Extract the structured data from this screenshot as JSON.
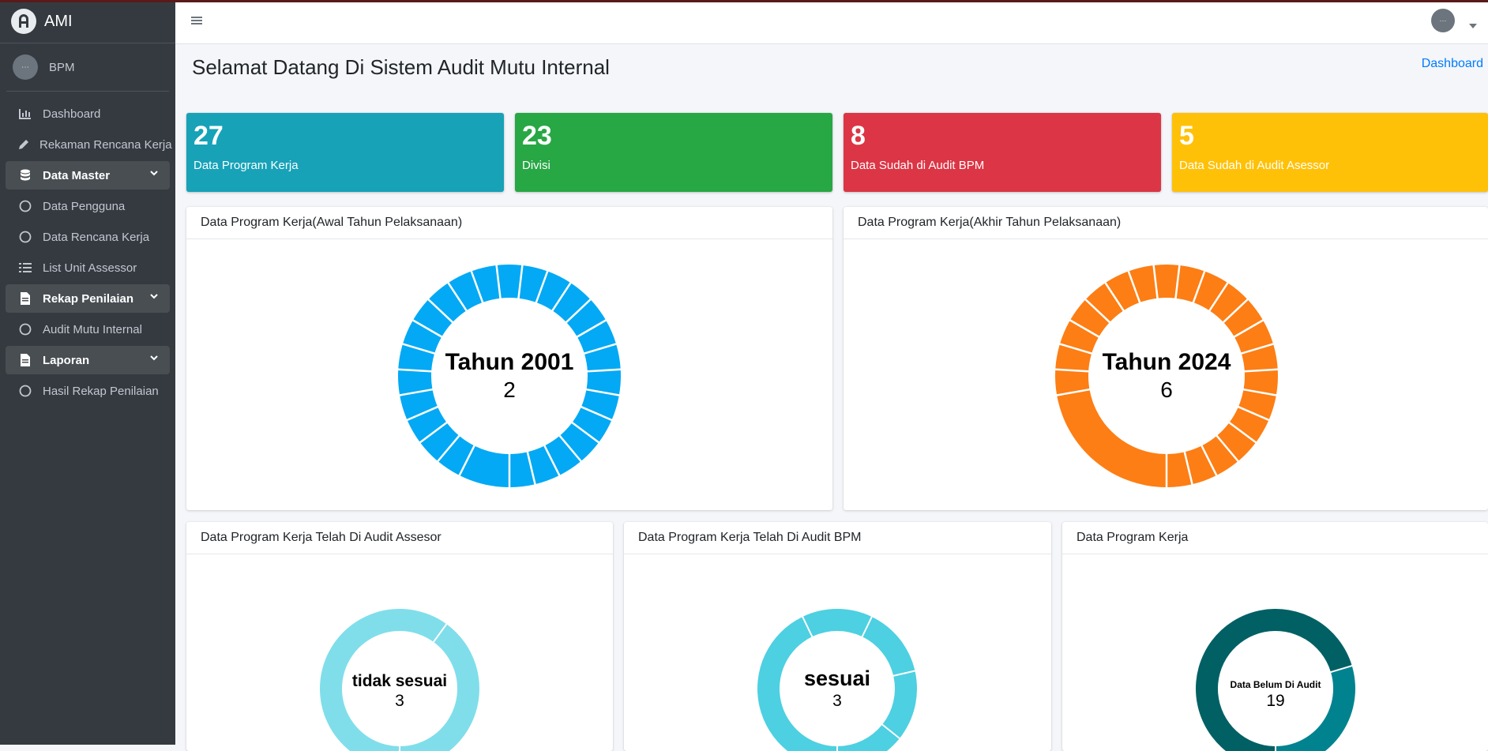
{
  "app": {
    "brand": "AMI",
    "user": "BPM"
  },
  "sidebar": {
    "items": [
      {
        "label": "Dashboard",
        "icon": "chart-bar-icon"
      },
      {
        "label": "Rekaman Rencana Kerja",
        "icon": "pencil-icon"
      },
      {
        "label": "Data Master",
        "icon": "database-icon"
      },
      {
        "label": "Data Pengguna",
        "icon": "circle-icon"
      },
      {
        "label": "Data Rencana Kerja",
        "icon": "circle-icon"
      },
      {
        "label": "List Unit Assessor",
        "icon": "list-icon"
      },
      {
        "label": "Rekap Penilaian",
        "icon": "file-icon"
      },
      {
        "label": "Audit Mutu Internal",
        "icon": "circle-icon"
      },
      {
        "label": "Laporan",
        "icon": "file-icon"
      },
      {
        "label": "Hasil Rekap Penilaian",
        "icon": "circle-icon"
      }
    ]
  },
  "page": {
    "title": "Selamat Datang Di Sistem Audit Mutu Internal",
    "breadcrumb": "Dashboard"
  },
  "stats": [
    {
      "value": "27",
      "label": "Data Program Kerja",
      "color": "#17a2b8"
    },
    {
      "value": "23",
      "label": "Divisi",
      "color": "#28a745"
    },
    {
      "value": "8",
      "label": "Data Sudah di Audit BPM",
      "color": "#dc3545"
    },
    {
      "value": "5",
      "label": "Data Sudah di Audit Asessor",
      "color": "#ffc107"
    }
  ],
  "cards": {
    "awal": {
      "title": "Data Program Kerja(Awal Tahun Pelaksanaan)",
      "center_label": "Tahun 2001",
      "center_value": "2"
    },
    "akhir": {
      "title": "Data Program Kerja(Akhir Tahun Pelaksanaan)",
      "center_label": "Tahun 2024",
      "center_value": "6"
    },
    "assesor": {
      "title": "Data Program Kerja Telah Di Audit Assesor",
      "center_label": "tidak sesuai",
      "center_value": "3"
    },
    "bpm": {
      "title": "Data Program Kerja Telah Di Audit BPM",
      "center_label": "sesuai",
      "center_value": "3"
    },
    "program": {
      "title": "Data Program Kerja",
      "center_label": "Data Belum Di Audit",
      "center_value": "19"
    }
  },
  "chart_data": [
    {
      "type": "pie",
      "name": "awal",
      "color": "#03a9f4",
      "values": [
        2,
        1,
        1,
        1,
        1,
        1,
        1,
        1,
        1,
        1,
        1,
        1,
        1,
        1,
        1,
        1,
        1,
        1,
        1,
        1,
        1,
        1,
        1,
        1,
        1,
        1
      ]
    },
    {
      "type": "pie",
      "name": "akhir",
      "color": "#fd7e14",
      "values": [
        6,
        1,
        1,
        1,
        1,
        1,
        1,
        1,
        1,
        1,
        1,
        1,
        1,
        1,
        1,
        1,
        1,
        1,
        1,
        1,
        1,
        1
      ]
    },
    {
      "type": "pie",
      "name": "assesor",
      "color": "#80deea",
      "values": [
        3,
        2
      ]
    },
    {
      "type": "pie",
      "name": "bpm",
      "color": "#4dd0e1",
      "values": [
        3,
        1,
        1,
        1,
        1
      ]
    },
    {
      "type": "pie",
      "name": "program",
      "colors": [
        "#006064",
        "#00838f"
      ],
      "values": [
        19,
        8
      ]
    }
  ]
}
